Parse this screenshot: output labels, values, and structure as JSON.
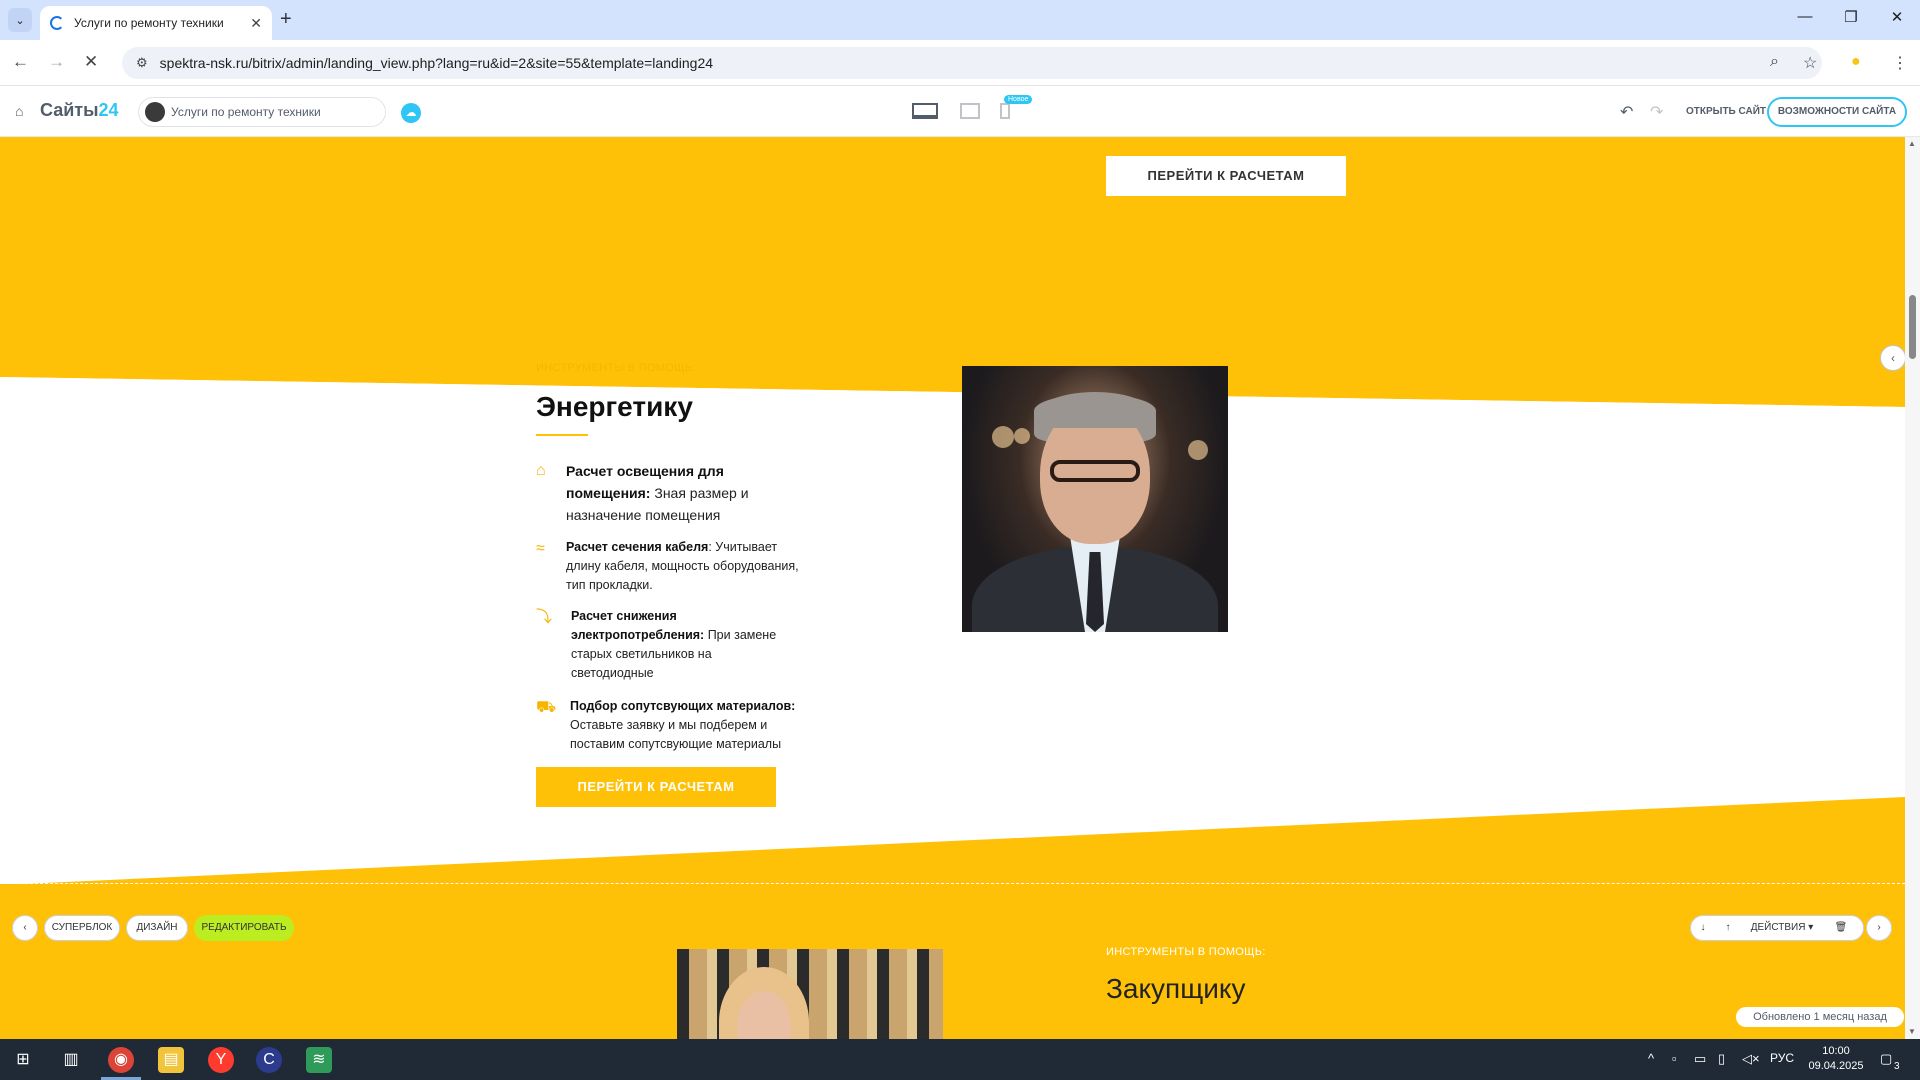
{
  "browser": {
    "tab_title": "Услуги по ремонту техники",
    "url_host": "spektra-nsk.ru",
    "url_path": "/bitrix/admin/landing_view.php?lang=ru&id=2&site=55&template=landing24",
    "new_tab": "+",
    "back": "←",
    "forward": "→",
    "reload": "✕",
    "minimize": "—",
    "restore": "❐",
    "close": "✕"
  },
  "bitrix": {
    "logo_main": "Сайты",
    "logo_num": "24",
    "site_name": "Услуги по ремонту техники",
    "badge_new": "Новое",
    "open_site": "ОТКРЫТЬ САЙТ",
    "features": "ВОЗМОЖНОСТИ САЙТА"
  },
  "page": {
    "top_button": "ПЕРЕЙТИ К РАСЧЕТАМ",
    "section1": {
      "subtitle": "ИНСТРУМЕНТЫ В ПОМОЩЬ:",
      "title": "Энергетику",
      "features": [
        {
          "icon": "house-icon",
          "bold": "Расчет освещения для помещения:",
          "text": " Зная размер и назначение помещения"
        },
        {
          "icon": "cable-icon",
          "bold": "Расчет сечения кабеля",
          "text": ": Учитывает длину кабеля, мощность оборудования, тип прокладки."
        },
        {
          "icon": "chart-down-icon",
          "bold": "Расчет снижения электропотребления:",
          "text": " При замене старых светильников на светодиодные"
        },
        {
          "icon": "truck-icon",
          "bold": "Подбор сопутсвующих материалов:",
          "text": " Оставьте заявку и мы подберем и поставим сопутсвующие материалы"
        }
      ],
      "button": "ПЕРЕЙТИ К РАСЧЕТАМ"
    },
    "section2": {
      "subtitle": "ИНСТРУМЕНТЫ В ПОМОЩЬ:",
      "title": "Закупщику"
    },
    "block_controls": {
      "prev": "‹",
      "superblock": "СУПЕРБЛОК",
      "design": "ДИЗАЙН",
      "edit": "РЕДАКТИРОВАТЬ",
      "down": "↓",
      "up": "↑",
      "actions": "ДЕЙСТВИЯ ▾",
      "delete": "🗑",
      "next": "›"
    },
    "updated": "Обновлено 1 месяц назад"
  },
  "taskbar": {
    "lang": "РУС",
    "time": "10:00",
    "date": "09.04.2025",
    "notifications": "3"
  },
  "colors": {
    "accent_yellow": "#ffc107",
    "bitrix_blue": "#2fc6f6",
    "edit_green": "#bbed21"
  }
}
